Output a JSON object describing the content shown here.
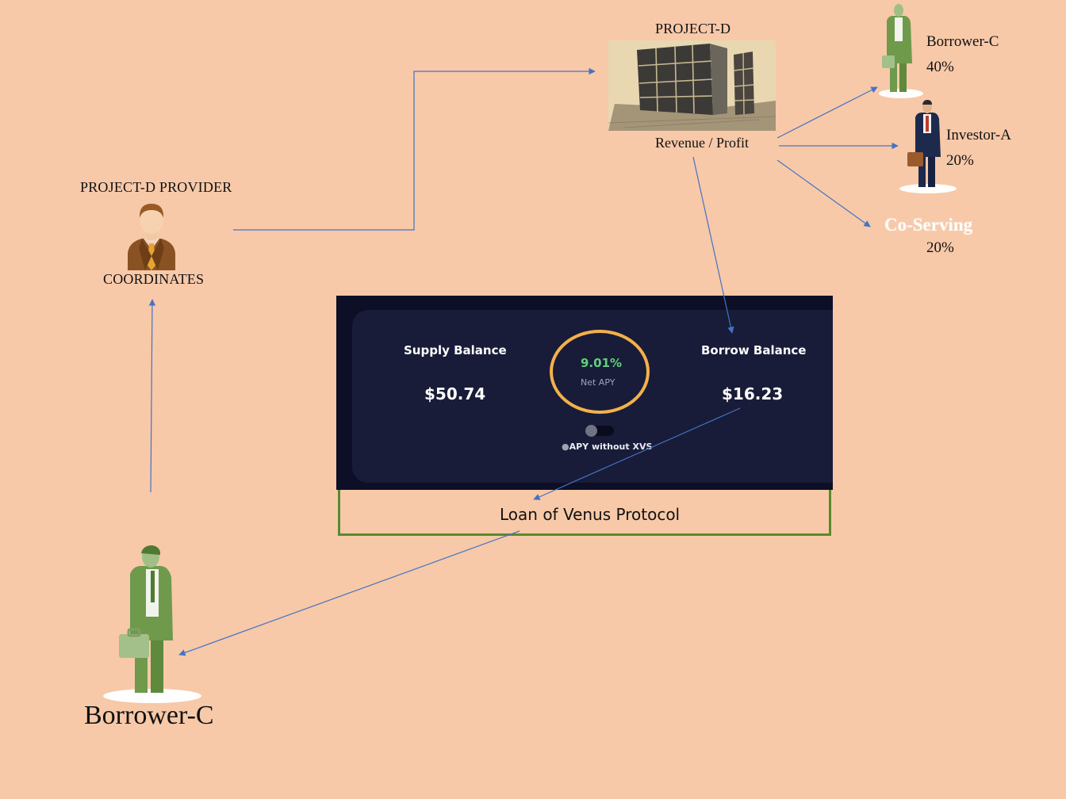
{
  "provider": {
    "title": "PROJECT-D PROVIDER",
    "role": "COORDINATES"
  },
  "project": {
    "title": "PROJECT-D",
    "revenue_label": "Revenue / Profit"
  },
  "distribution": {
    "borrower": {
      "name": "Borrower-C",
      "share": "40%"
    },
    "investor": {
      "name": "Investor-A",
      "share": "20%"
    },
    "coserving": {
      "name": "Co-Serving",
      "share": "20%"
    }
  },
  "venus": {
    "supply_title": "Supply Balance",
    "supply_value": "$50.74",
    "apy_value": "9.01%",
    "apy_label": "Net APY",
    "borrow_title": "Borrow Balance",
    "borrow_value": "$16.23",
    "toggle_label": "APY without XVS",
    "caption": "Loan of Venus Protocol"
  },
  "borrower_bottom": {
    "name": "Borrower-C"
  },
  "colors": {
    "background": "#f8c9a8",
    "arrow": "#4472c4",
    "frame": "#5a8a2e",
    "panel": "#0c0f26",
    "apy_ring": "#f3b14b",
    "apy_text": "#5ed27a",
    "suit_green": "#6f9a4c",
    "suit_navy": "#1d2a4d"
  }
}
